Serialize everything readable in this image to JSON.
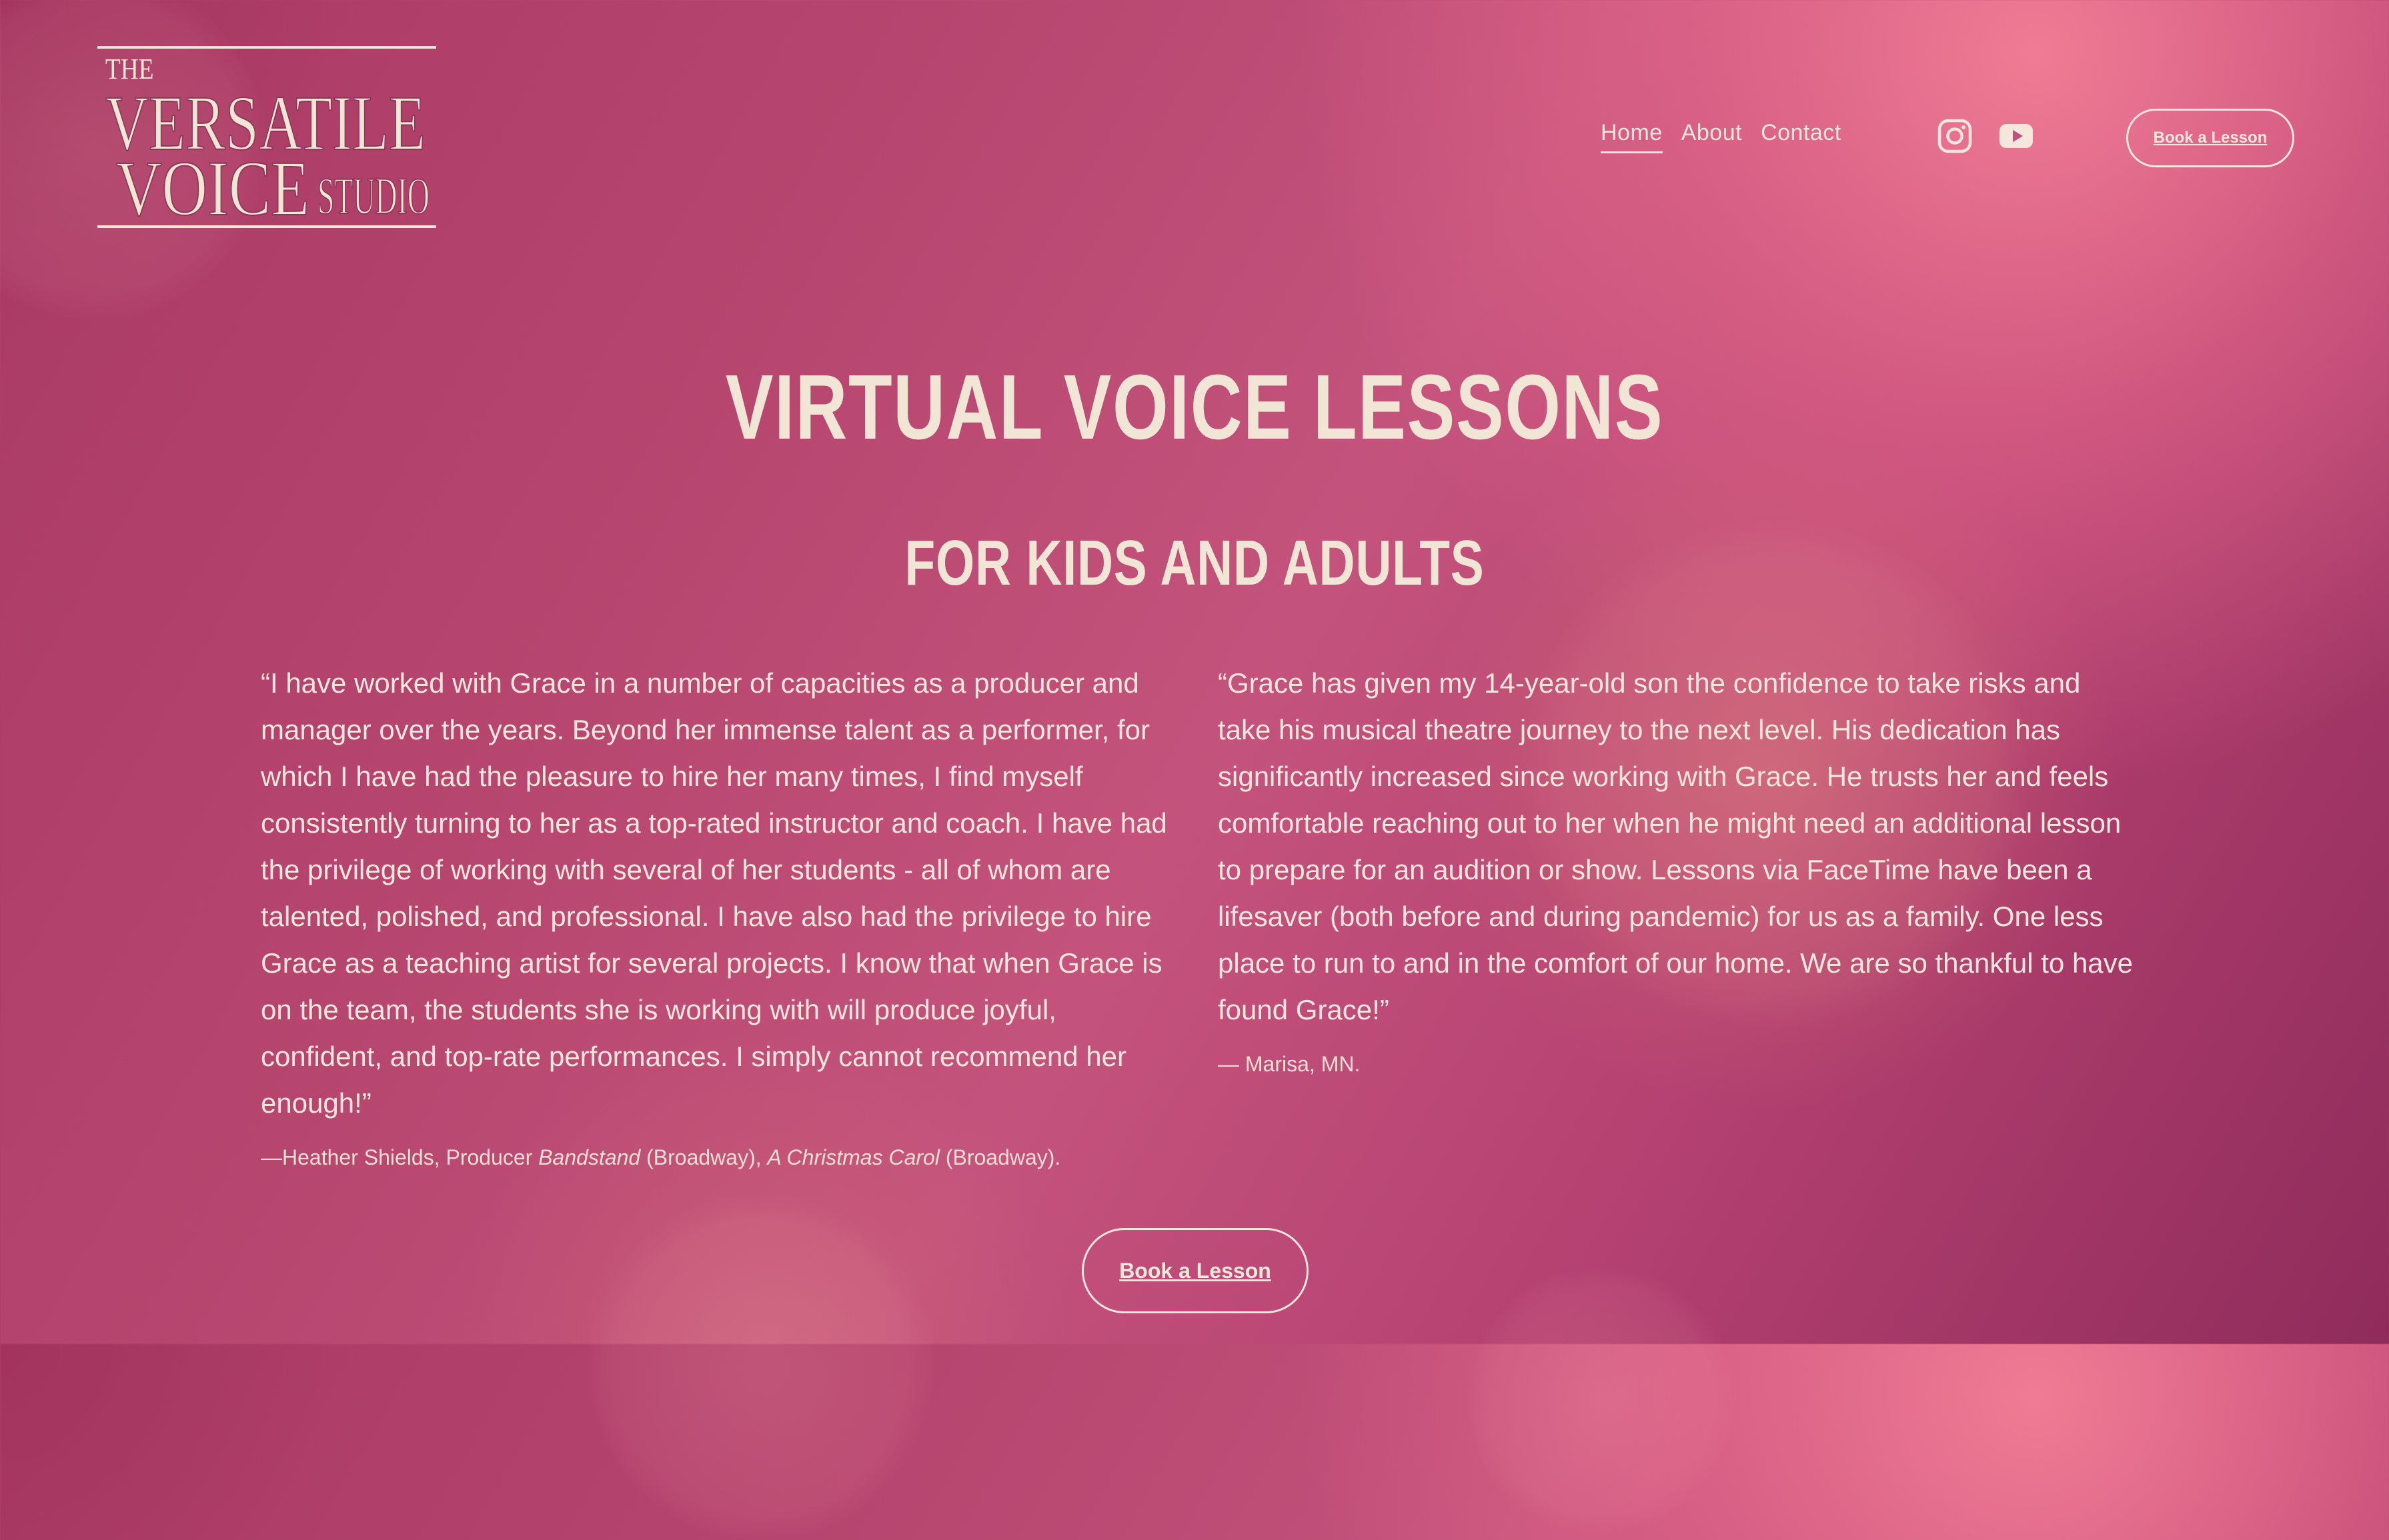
{
  "brand": {
    "logo_text_the": "THE",
    "logo_text_versatile": "VERSATILE",
    "logo_text_voice": "VOICE",
    "logo_text_studio": "STUDIO"
  },
  "nav": {
    "items": [
      {
        "label": "Home",
        "active": true
      },
      {
        "label": "About",
        "active": false
      },
      {
        "label": "Contact",
        "active": false
      }
    ]
  },
  "social": {
    "icons": [
      "instagram-icon",
      "youtube-icon"
    ]
  },
  "header_cta": {
    "label": "Book a Lesson"
  },
  "hero": {
    "title": "VIRTUAL VOICE LESSONS",
    "subtitle": "FOR KIDS AND ADULTS"
  },
  "testimonials": [
    {
      "quote": "“I have worked with Grace in a number of capacities as a producer and manager over the years. Beyond her immense talent as a performer, for which I have had the pleasure to hire her many times, I find myself consistently turning to her as a top-rated instructor and coach. I have had the privilege of working with several of her students - all of whom are talented, polished, and professional. I have also had the privilege to hire Grace as a teaching artist for several projects. I know that when Grace is on the team, the students she is working with will produce joyful, confident, and top-rate performances. I simply cannot recommend her enough!”",
      "attribution_prefix": "—Heather Shields, Producer ",
      "attribution_title1": "Bandstand",
      "attribution_mid": " (Broadway), ",
      "attribution_title2": "A Christmas Carol",
      "attribution_suffix": " (Broadway)."
    },
    {
      "quote": "“Grace has given my 14-year-old son the confidence to take risks and take his musical theatre  journey to the next level. His dedication has significantly increased since working with Grace. He trusts her and feels comfortable reaching out to her when he might need an additional lesson to prepare for an audition or show. Lessons via FaceTime have been a lifesaver (both before and during pandemic) for us as a family. One less place to run to and in the comfort of our home. We are so thankful to have found Grace!”",
      "attribution": "— Marisa, MN."
    }
  ],
  "bottom_cta": {
    "label": "Book a Lesson"
  },
  "colors": {
    "background_primary": "#b7466f",
    "background_highlight": "#ec7a93",
    "text_cream": "#f1e6d6"
  }
}
